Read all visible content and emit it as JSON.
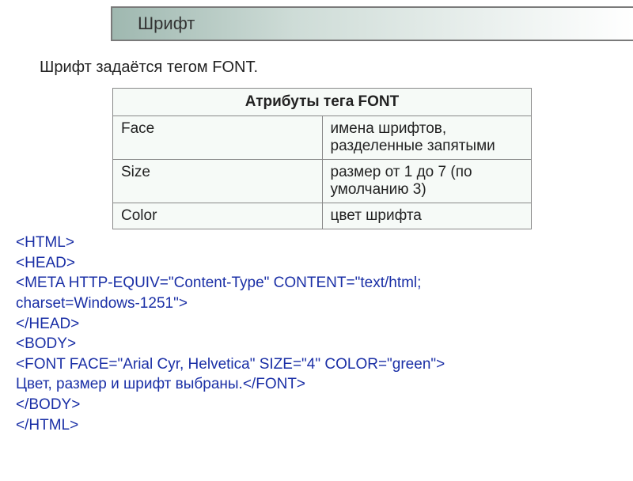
{
  "title": "Шрифт",
  "intro": "Шрифт задаётся тегом FONT.",
  "table": {
    "header": "Атрибуты тега FONT",
    "rows": [
      {
        "name": "Face",
        "desc": "имена шрифтов, разделенные запятыми"
      },
      {
        "name": "Size",
        "desc": "размер от 1 до 7 (по умолчанию 3)"
      },
      {
        "name": "Color",
        "desc": "цвет шрифта"
      }
    ]
  },
  "code": "<HTML>\n<HEAD>\n<META HTTP-EQUIV=\"Content-Type\" CONTENT=\"text/html;\ncharset=Windows-1251\">\n</HEAD>\n<BODY>\n<FONT FACE=\"Arial Cyr, Helvetica\" SIZE=\"4\" COLOR=\"green\">\nЦвет, размер и шрифт выбраны.</FONT>\n</BODY>\n</HTML>"
}
